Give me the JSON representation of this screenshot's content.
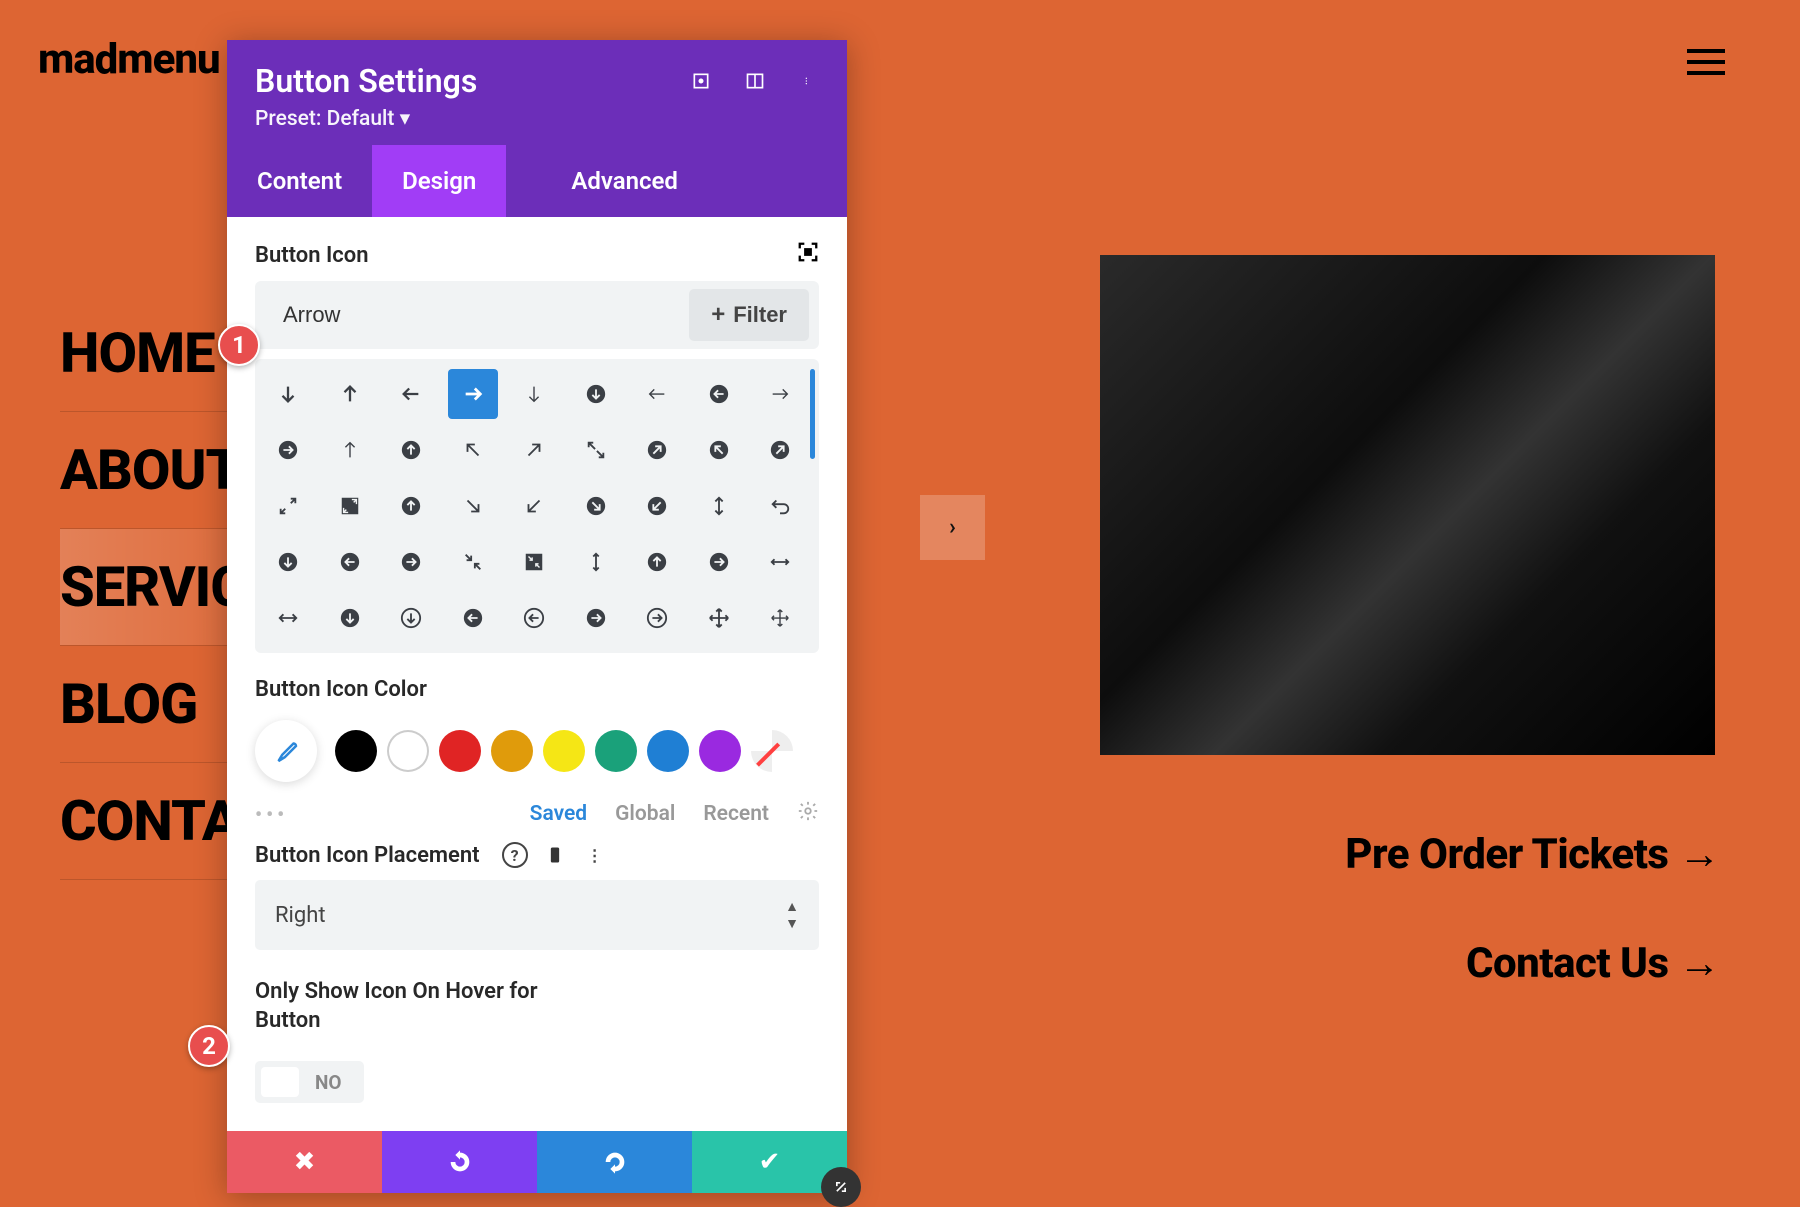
{
  "logo": "madmenu",
  "menu": {
    "items": [
      "HOME",
      "ABOUT",
      "SERVICES",
      "BLOG",
      "CONTACT"
    ],
    "active_index": 2
  },
  "cta": {
    "primary": "Pre Order Tickets",
    "secondary": "Contact Us"
  },
  "panel": {
    "title": "Button Settings",
    "preset": "Preset: Default ▾",
    "tabs": {
      "content": "Content",
      "design": "Design",
      "advanced": "Advanced",
      "active": "design"
    },
    "section_icon": "Button Icon",
    "icon_search": "Arrow",
    "filter_btn": "Filter",
    "section_color": "Button Icon Color",
    "color_tabs": {
      "saved": "Saved",
      "global": "Global",
      "recent": "Recent"
    },
    "section_placement": "Button Icon Placement",
    "placement_value": "Right",
    "section_hover": "Only Show Icon On Hover for Button",
    "toggle_value": "NO",
    "swatches": [
      "#000000",
      "#ffffff",
      "#e02424",
      "#e09b0b",
      "#f5e615",
      "#1aa17a",
      "#1f7fd4",
      "#9a29e0"
    ]
  },
  "annotations": {
    "one": "1",
    "two": "2"
  }
}
